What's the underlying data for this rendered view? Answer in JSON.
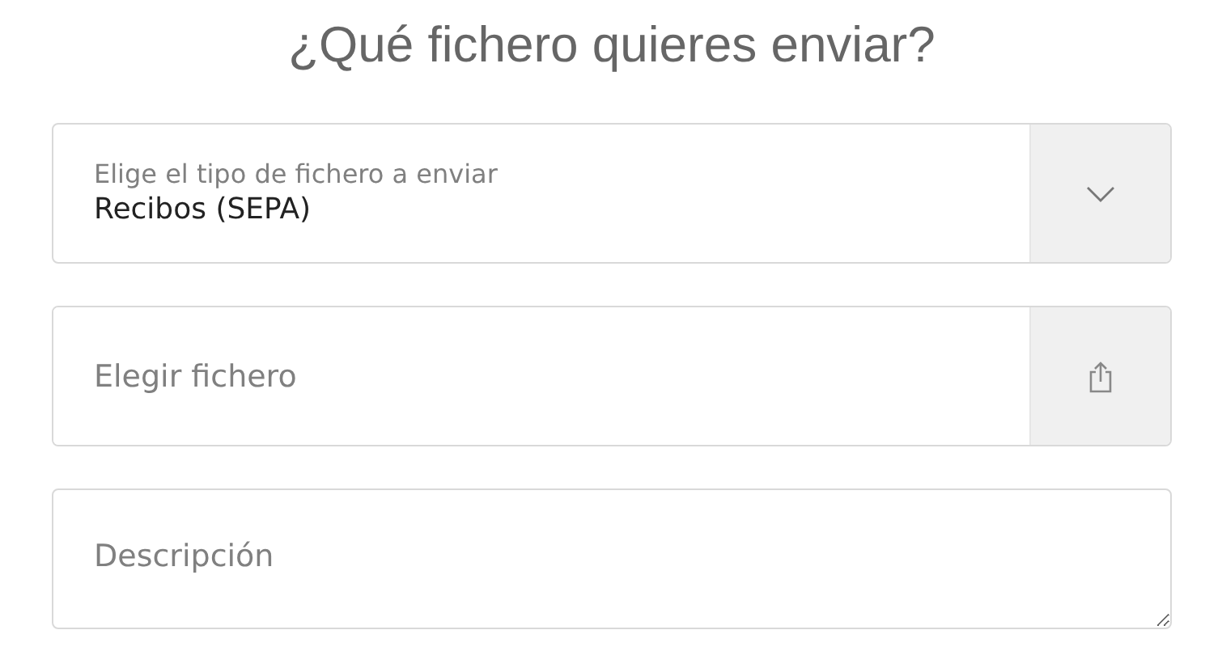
{
  "heading": "¿Qué fichero quieres enviar?",
  "file_type": {
    "label": "Elige el tipo de fichero a enviar",
    "value": "Recibos (SEPA)"
  },
  "file_picker": {
    "placeholder": "Elegir fichero"
  },
  "description": {
    "placeholder": "Descripción"
  }
}
